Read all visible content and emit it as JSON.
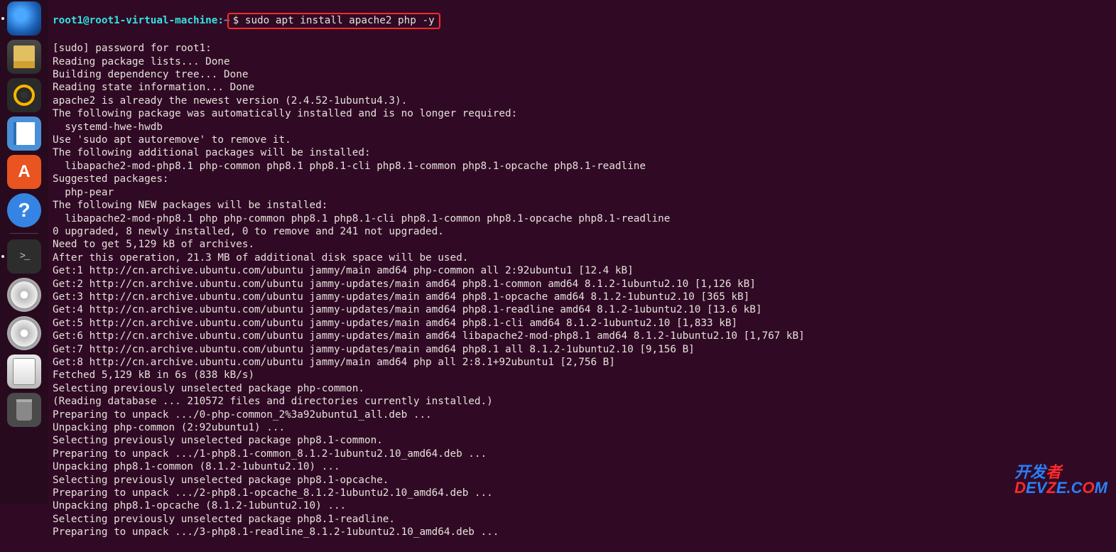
{
  "dock": {
    "items": [
      {
        "name": "thunderbird-icon",
        "label": "Thunderbird"
      },
      {
        "name": "files-icon",
        "label": "Files"
      },
      {
        "name": "rhythmbox-icon",
        "label": "Rhythmbox"
      },
      {
        "name": "writer-icon",
        "label": "LibreOffice Writer"
      },
      {
        "name": "software-icon",
        "label": "Ubuntu Software"
      },
      {
        "name": "help-icon",
        "label": "Help"
      },
      {
        "name": "terminal-icon",
        "label": "Terminal"
      },
      {
        "name": "disc1-icon",
        "label": "Disc"
      },
      {
        "name": "disc2-icon",
        "label": "Disc"
      },
      {
        "name": "disk-icon",
        "label": "Removable Disk"
      },
      {
        "name": "trash-icon",
        "label": "Trash"
      }
    ]
  },
  "prompt": {
    "user": "root1@root1-virtual-machine",
    "sep": ":",
    "path": "~",
    "dollar": "$ ",
    "command": "sudo apt install apache2 php -y"
  },
  "output": [
    "[sudo] password for root1:",
    "Reading package lists... Done",
    "Building dependency tree... Done",
    "Reading state information... Done",
    "apache2 is already the newest version (2.4.52-1ubuntu4.3).",
    "The following package was automatically installed and is no longer required:",
    "  systemd-hwe-hwdb",
    "Use 'sudo apt autoremove' to remove it.",
    "The following additional packages will be installed:",
    "  libapache2-mod-php8.1 php-common php8.1 php8.1-cli php8.1-common php8.1-opcache php8.1-readline",
    "Suggested packages:",
    "  php-pear",
    "The following NEW packages will be installed:",
    "  libapache2-mod-php8.1 php php-common php8.1 php8.1-cli php8.1-common php8.1-opcache php8.1-readline",
    "0 upgraded, 8 newly installed, 0 to remove and 241 not upgraded.",
    "Need to get 5,129 kB of archives.",
    "After this operation, 21.3 MB of additional disk space will be used.",
    "Get:1 http://cn.archive.ubuntu.com/ubuntu jammy/main amd64 php-common all 2:92ubuntu1 [12.4 kB]",
    "Get:2 http://cn.archive.ubuntu.com/ubuntu jammy-updates/main amd64 php8.1-common amd64 8.1.2-1ubuntu2.10 [1,126 kB]",
    "Get:3 http://cn.archive.ubuntu.com/ubuntu jammy-updates/main amd64 php8.1-opcache amd64 8.1.2-1ubuntu2.10 [365 kB]",
    "Get:4 http://cn.archive.ubuntu.com/ubuntu jammy-updates/main amd64 php8.1-readline amd64 8.1.2-1ubuntu2.10 [13.6 kB]",
    "Get:5 http://cn.archive.ubuntu.com/ubuntu jammy-updates/main amd64 php8.1-cli amd64 8.1.2-1ubuntu2.10 [1,833 kB]",
    "Get:6 http://cn.archive.ubuntu.com/ubuntu jammy-updates/main amd64 libapache2-mod-php8.1 amd64 8.1.2-1ubuntu2.10 [1,767 kB]",
    "Get:7 http://cn.archive.ubuntu.com/ubuntu jammy-updates/main amd64 php8.1 all 8.1.2-1ubuntu2.10 [9,156 B]",
    "Get:8 http://cn.archive.ubuntu.com/ubuntu jammy/main amd64 php all 2:8.1+92ubuntu1 [2,756 B]",
    "Fetched 5,129 kB in 6s (838 kB/s)",
    "Selecting previously unselected package php-common.",
    "(Reading database ... 210572 files and directories currently installed.)",
    "Preparing to unpack .../0-php-common_2%3a92ubuntu1_all.deb ...",
    "Unpacking php-common (2:92ubuntu1) ...",
    "Selecting previously unselected package php8.1-common.",
    "Preparing to unpack .../1-php8.1-common_8.1.2-1ubuntu2.10_amd64.deb ...",
    "Unpacking php8.1-common (8.1.2-1ubuntu2.10) ...",
    "Selecting previously unselected package php8.1-opcache.",
    "Preparing to unpack .../2-php8.1-opcache_8.1.2-1ubuntu2.10_amd64.deb ...",
    "Unpacking php8.1-opcache (8.1.2-1ubuntu2.10) ...",
    "Selecting previously unselected package php8.1-readline.",
    "Preparing to unpack .../3-php8.1-readline_8.1.2-1ubuntu2.10_amd64.deb ..."
  ],
  "watermark": {
    "line1_a": "开发",
    "line1_b": "者",
    "line2_a": "D",
    "line2_b": "EV",
    "line2_c": "Z",
    "line2_d": "E.C",
    "line2_e": "O",
    "line2_f": "M"
  }
}
